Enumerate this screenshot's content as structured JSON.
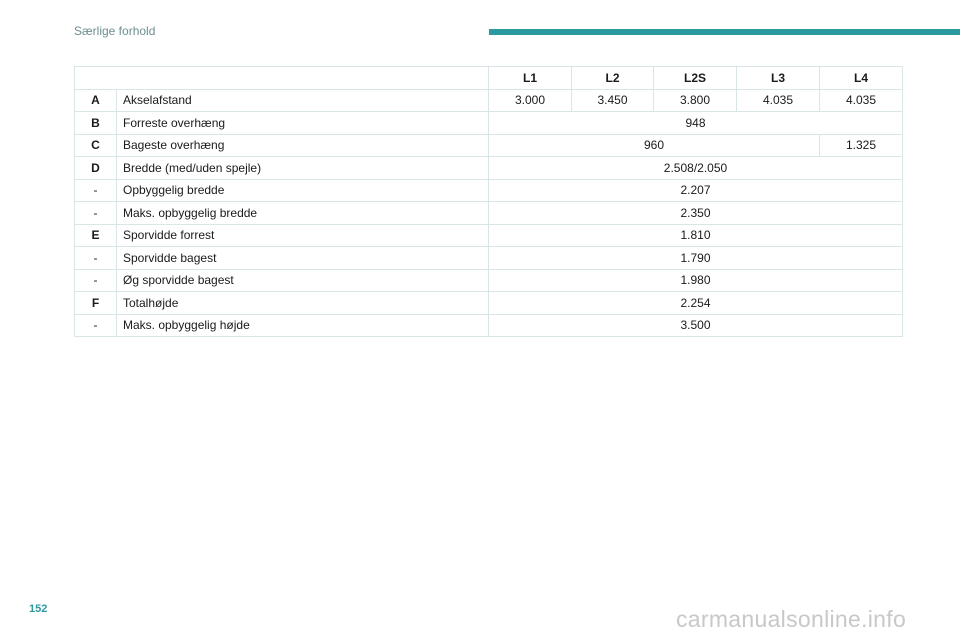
{
  "header": {
    "section_title": "Særlige forhold"
  },
  "table": {
    "columns": [
      "L1",
      "L2",
      "L2S",
      "L3",
      "L4"
    ],
    "rows": [
      {
        "code": "A",
        "label": "Akselafstand",
        "values": [
          "3.000",
          "3.450",
          "3.800",
          "4.035",
          "4.035"
        ]
      },
      {
        "code": "B",
        "label": "Forreste overhæng",
        "value": "948"
      },
      {
        "code": "C",
        "label": "Bageste overhæng",
        "value_l1_l3": "960",
        "value_l4": "1.325"
      },
      {
        "code": "D",
        "label": "Bredde (med/uden spejle)",
        "value": "2.508/2.050"
      },
      {
        "code": "-",
        "label": "Opbyggelig bredde",
        "value": "2.207"
      },
      {
        "code": "-",
        "label": "Maks. opbyggelig bredde",
        "value": "2.350"
      },
      {
        "code": "E",
        "label": "Sporvidde forrest",
        "value": "1.810"
      },
      {
        "code": "-",
        "label": "Sporvidde bagest",
        "value": "1.790"
      },
      {
        "code": "-",
        "label": "Øg sporvidde bagest",
        "value": "1.980"
      },
      {
        "code": "F",
        "label": "Totalhøjde",
        "value": "2.254"
      },
      {
        "code": "-",
        "label": "Maks. opbyggelig højde",
        "value": "3.500"
      }
    ]
  },
  "footer": {
    "page_number": "152",
    "watermark": "carmanualsonline.info"
  },
  "colors": {
    "accent": "#2a9aa0",
    "border": "#d9e6e8",
    "muted_text": "#6b8f93"
  }
}
